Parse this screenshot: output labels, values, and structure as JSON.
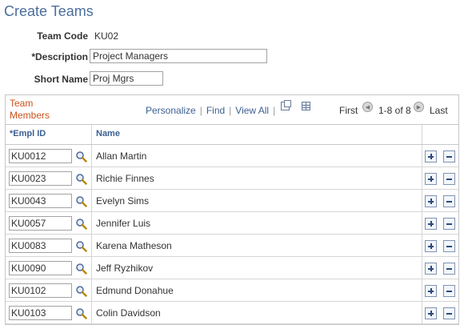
{
  "page": {
    "title": "Create Teams"
  },
  "form": {
    "team_code_label": "Team Code",
    "team_code_value": "KU02",
    "description_label": "*Description",
    "description_value": "Project Managers",
    "short_name_label": "Short Name",
    "short_name_value": "Proj Mgrs"
  },
  "grid": {
    "title": "Team Members",
    "nav": {
      "personalize": "Personalize",
      "find": "Find",
      "view_all": "View All",
      "first": "First",
      "range": "1-8 of 8",
      "last": "Last"
    },
    "columns": {
      "empl_id": "*Empl ID",
      "name": "Name"
    },
    "rows": [
      {
        "empl_id": "KU0012",
        "name": "Allan Martin"
      },
      {
        "empl_id": "KU0023",
        "name": "Richie Finnes"
      },
      {
        "empl_id": "KU0043",
        "name": "Evelyn Sims"
      },
      {
        "empl_id": "KU0057",
        "name": "Jennifer Luis"
      },
      {
        "empl_id": "KU0083",
        "name": "Karena Matheson"
      },
      {
        "empl_id": "KU0090",
        "name": "Jeff Ryzhikov"
      },
      {
        "empl_id": "KU0102",
        "name": "Edmund Donahue"
      },
      {
        "empl_id": "KU0103",
        "name": "Colin Davidson"
      }
    ]
  },
  "icons": {
    "lookup": "magnifier-icon",
    "add_row": "plus-icon",
    "delete_row": "minus-icon",
    "new_window": "new-window-icon",
    "download": "spreadsheet-icon",
    "prev": "previous-arrow-icon",
    "next": "next-arrow-icon"
  },
  "colors": {
    "title": "#4b6e9c",
    "grid_title": "#c9521d",
    "link": "#3b5f91"
  }
}
